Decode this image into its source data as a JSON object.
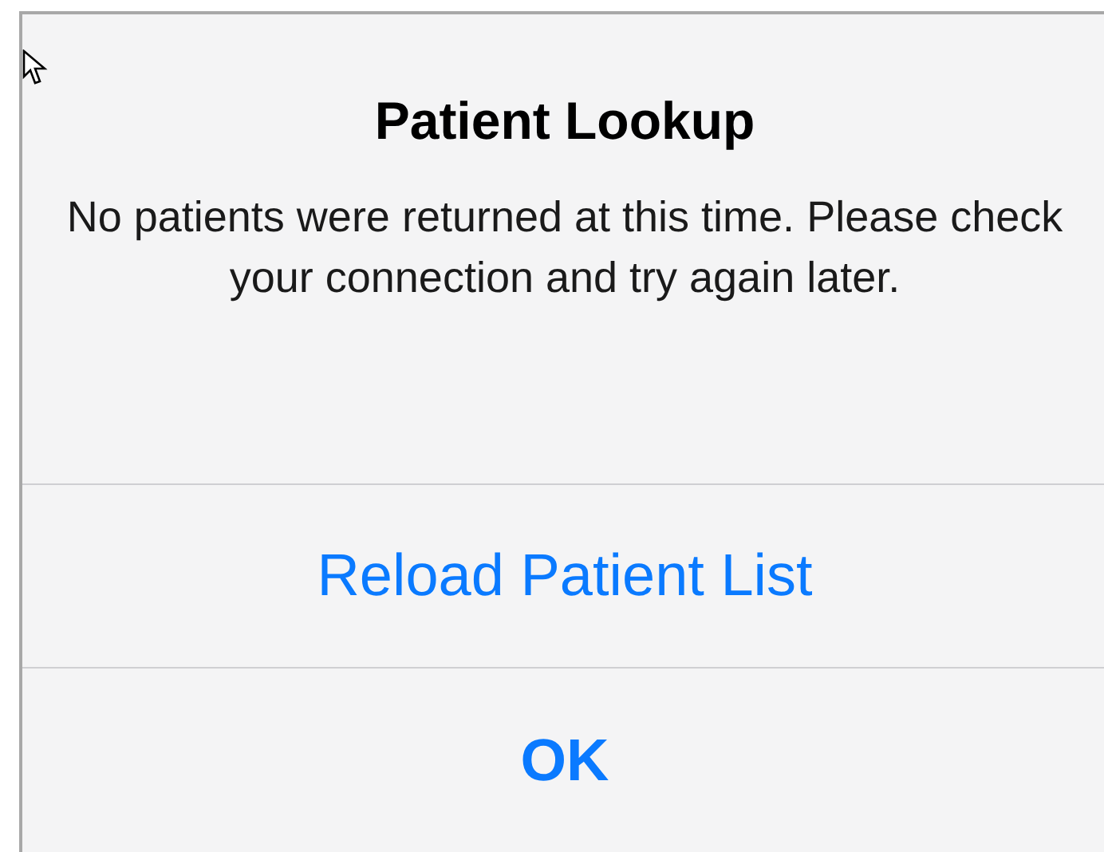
{
  "alert": {
    "title": "Patient Lookup",
    "message": "No patients were returned at this time. Please check your connection and try again later.",
    "buttons": [
      {
        "label": "Reload Patient List",
        "bold": false
      },
      {
        "label": "OK",
        "bold": true
      }
    ]
  }
}
